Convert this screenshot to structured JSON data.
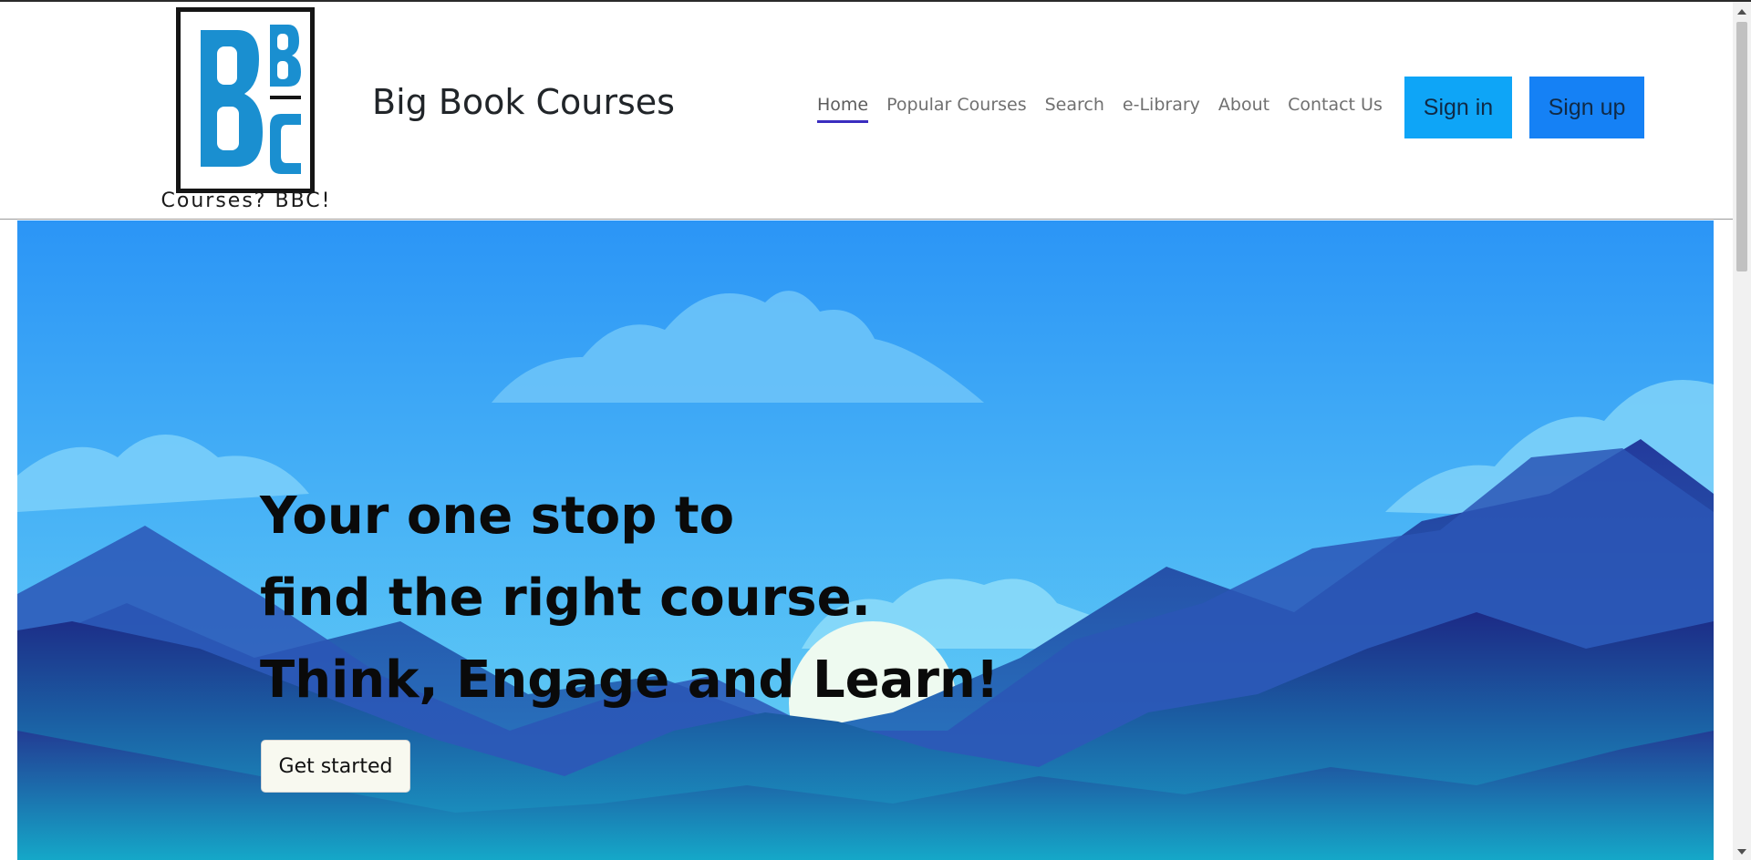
{
  "header": {
    "logo": {
      "letters": "BBC",
      "tagline": "Courses? BBC!"
    },
    "brand_title": "Big Book Courses",
    "nav": [
      {
        "label": "Home",
        "active": true
      },
      {
        "label": "Popular Courses"
      },
      {
        "label": "Search"
      },
      {
        "label": "e-Library"
      },
      {
        "label": "About"
      },
      {
        "label": "Contact Us"
      }
    ],
    "signin_label": "Sign in",
    "signup_label": "Sign up"
  },
  "hero": {
    "lines": [
      "Your one stop to",
      "find the right course.",
      "Think, Engage and Learn!"
    ],
    "cta_label": "Get started"
  },
  "colors": {
    "signin_bg": "#0ea5f7",
    "signup_bg": "#1581f5",
    "sky_top": "#2b95f6",
    "sky_bottom": "#6bd6f5",
    "mountain_dark": "#1f2f8a",
    "nav_active_underline": "#3a2dbf"
  }
}
